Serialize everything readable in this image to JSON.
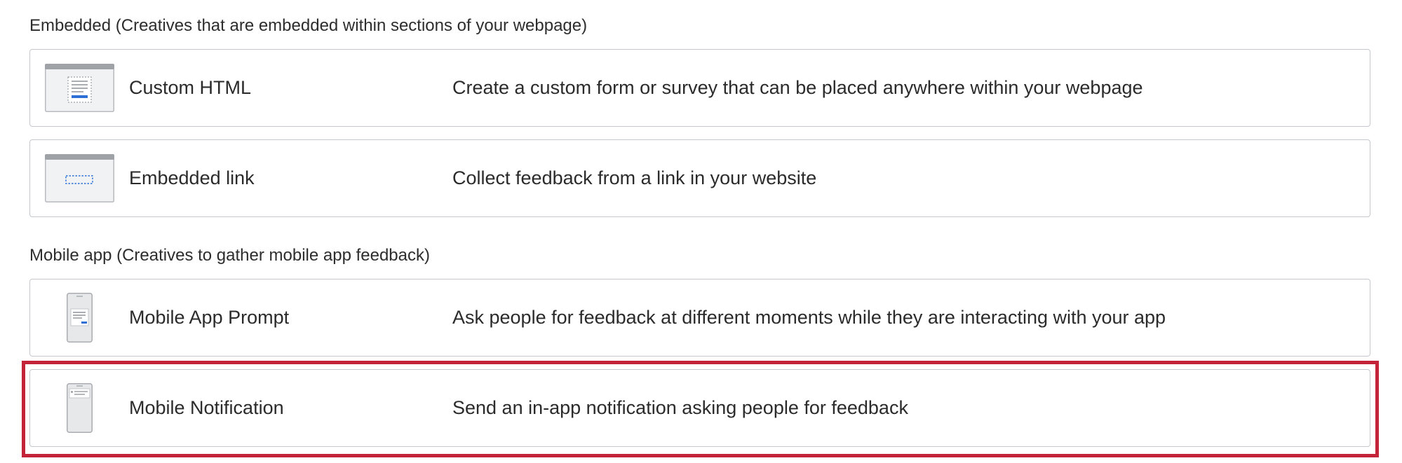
{
  "sections": [
    {
      "heading": "Embedded (Creatives that are embedded within sections of your webpage)",
      "options": [
        {
          "name": "Custom HTML",
          "description": "Create a custom form or survey that can be placed anywhere within your webpage",
          "icon": "custom-html-icon"
        },
        {
          "name": "Embedded link",
          "description": "Collect feedback from a link in your website",
          "icon": "embedded-link-icon"
        }
      ]
    },
    {
      "heading": "Mobile app (Creatives to gather mobile app feedback)",
      "options": [
        {
          "name": "Mobile App Prompt",
          "description": "Ask people for feedback at different moments while they are interacting with your app",
          "icon": "mobile-app-prompt-icon"
        },
        {
          "name": "Mobile Notification",
          "description": "Send an in-app notification asking people for feedback",
          "icon": "mobile-notification-icon",
          "highlighted": true
        }
      ]
    }
  ],
  "colors": {
    "highlight": "#c3243a",
    "card_border": "#c4c8cc",
    "icon_accent": "#2e6fd6"
  }
}
